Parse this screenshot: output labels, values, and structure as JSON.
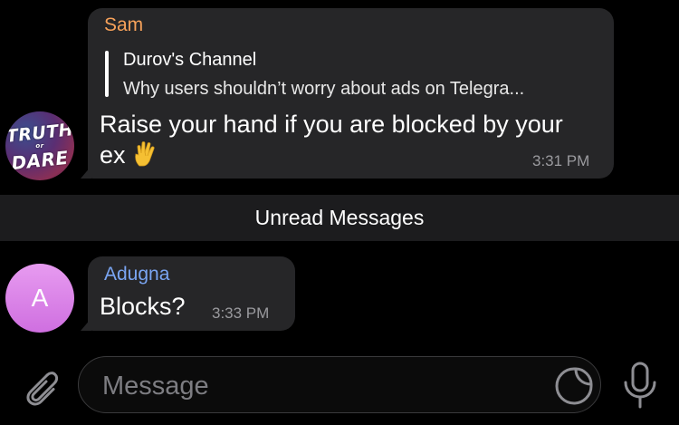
{
  "messages": [
    {
      "sender": "Sam",
      "sender_color": "#f6a15a",
      "avatar": {
        "line1": "TRUTH",
        "line2": "or",
        "line3": "DARE"
      },
      "reply": {
        "title": "Durov's Channel",
        "text": "Why users shouldn’t worry about ads on Telegra..."
      },
      "text": "Raise your hand if you are blocked by your ex",
      "emoji": "vulcan-salute-hand",
      "time": "3:31 PM"
    },
    {
      "sender": "Adugna",
      "sender_color": "#7aa5f2",
      "avatar": {
        "initial": "A"
      },
      "text": "Blocks?",
      "time": "3:33 PM"
    }
  ],
  "unread_banner": "Unread Messages",
  "composer": {
    "placeholder": "Message",
    "attach_icon": "paperclip-icon",
    "sticker_icon": "sticker-icon",
    "mic_icon": "microphone-icon"
  },
  "colors": {
    "background": "#000000",
    "bubble": "#262628",
    "banner": "#1c1c1e",
    "time": "#9a9a9e"
  }
}
